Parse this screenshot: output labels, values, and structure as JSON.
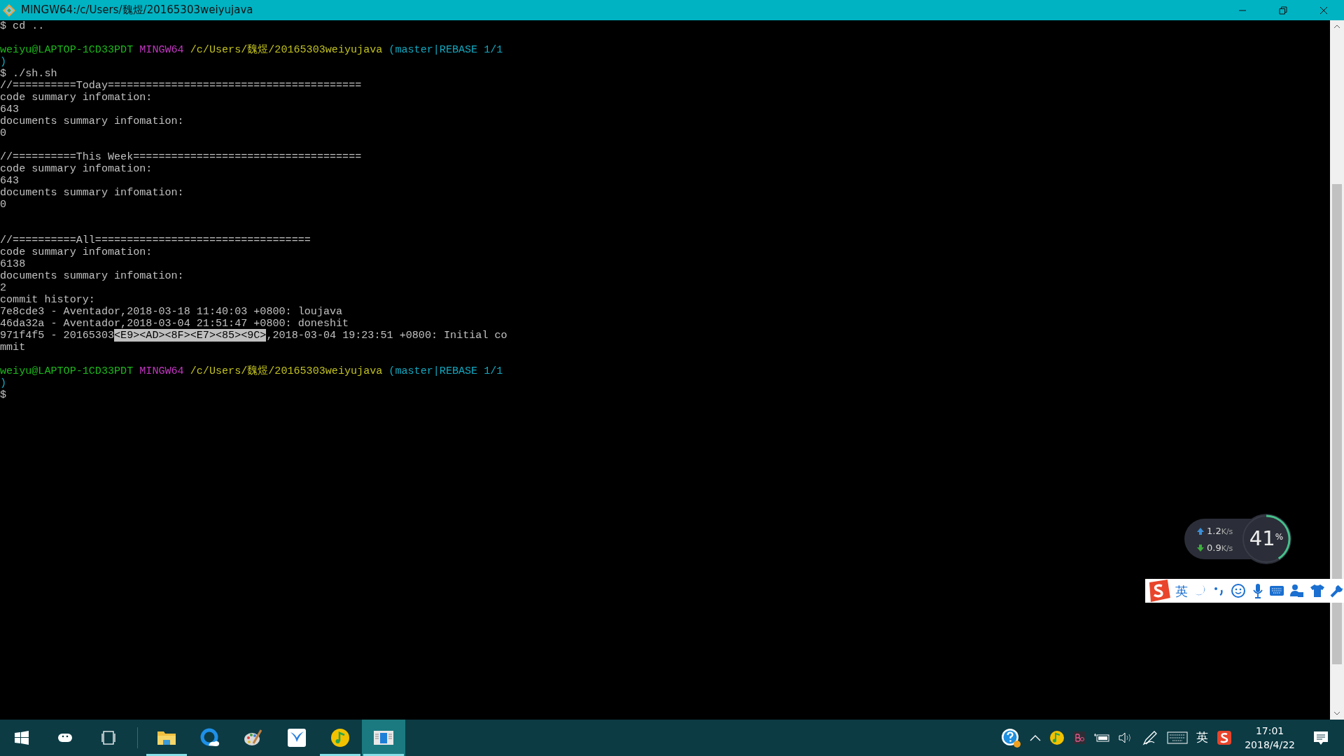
{
  "window": {
    "title": "MINGW64:/c/Users/魏煜/20165303weiyujava"
  },
  "terminal": {
    "lines": [
      {
        "segments": [
          {
            "kind": "plain",
            "text": "$ cd .."
          }
        ]
      },
      {
        "kind": "blank"
      },
      {
        "segments": [
          {
            "kind": "user",
            "text": "weiyu@LAPTOP-1CD33PDT"
          },
          {
            "kind": "shell",
            "text": " MINGW64"
          },
          {
            "kind": "path",
            "text": " /c/Users/魏煜/20165303weiyujava"
          },
          {
            "kind": "branch",
            "text": " (master|REBASE 1/1"
          }
        ]
      },
      {
        "segments": [
          {
            "kind": "branch",
            "text": ")"
          }
        ]
      },
      {
        "segments": [
          {
            "kind": "plain",
            "text": "$ ./sh.sh"
          }
        ]
      },
      {
        "segments": [
          {
            "kind": "plain",
            "text": "//==========Today========================================"
          }
        ]
      },
      {
        "segments": [
          {
            "kind": "plain",
            "text": "code summary infomation:"
          }
        ]
      },
      {
        "segments": [
          {
            "kind": "plain",
            "text": "643"
          }
        ]
      },
      {
        "segments": [
          {
            "kind": "plain",
            "text": "documents summary infomation:"
          }
        ]
      },
      {
        "segments": [
          {
            "kind": "plain",
            "text": "0"
          }
        ]
      },
      {
        "kind": "blank"
      },
      {
        "segments": [
          {
            "kind": "plain",
            "text": "//==========This Week===================================="
          }
        ]
      },
      {
        "segments": [
          {
            "kind": "plain",
            "text": "code summary infomation:"
          }
        ]
      },
      {
        "segments": [
          {
            "kind": "plain",
            "text": "643"
          }
        ]
      },
      {
        "segments": [
          {
            "kind": "plain",
            "text": "documents summary infomation:"
          }
        ]
      },
      {
        "segments": [
          {
            "kind": "plain",
            "text": "0"
          }
        ]
      },
      {
        "kind": "blank"
      },
      {
        "kind": "blank"
      },
      {
        "segments": [
          {
            "kind": "plain",
            "text": "//==========All=================================="
          }
        ]
      },
      {
        "segments": [
          {
            "kind": "plain",
            "text": "code summary infomation:"
          }
        ]
      },
      {
        "segments": [
          {
            "kind": "plain",
            "text": "6138"
          }
        ]
      },
      {
        "segments": [
          {
            "kind": "plain",
            "text": "documents summary infomation:"
          }
        ]
      },
      {
        "segments": [
          {
            "kind": "plain",
            "text": "2"
          }
        ]
      },
      {
        "segments": [
          {
            "kind": "plain",
            "text": "commit history:"
          }
        ]
      },
      {
        "segments": [
          {
            "kind": "plain",
            "text": "7e8cde3 - Aventador,2018-03-18 11:40:03 +0800: loujava"
          }
        ]
      },
      {
        "segments": [
          {
            "kind": "plain",
            "text": "46da32a - Aventador,2018-03-04 21:51:47 +0800: doneshit"
          }
        ]
      },
      {
        "segments": [
          {
            "kind": "plain",
            "text": "971f4f5 - 20165303"
          },
          {
            "kind": "selection",
            "text": "<E9><AD><8F><E7><85><9C>"
          },
          {
            "kind": "plain",
            "text": ",2018-03-04 19:23:51 +0800: Initial co"
          }
        ]
      },
      {
        "segments": [
          {
            "kind": "plain",
            "text": "mmit"
          }
        ]
      },
      {
        "kind": "blank"
      },
      {
        "segments": [
          {
            "kind": "user",
            "text": "weiyu@LAPTOP-1CD33PDT"
          },
          {
            "kind": "shell",
            "text": " MINGW64"
          },
          {
            "kind": "path",
            "text": " /c/Users/魏煜/20165303weiyujava"
          },
          {
            "kind": "branch",
            "text": " (master|REBASE 1/1"
          }
        ]
      },
      {
        "segments": [
          {
            "kind": "branch",
            "text": ")"
          }
        ]
      },
      {
        "segments": [
          {
            "kind": "plain",
            "text": "$"
          }
        ]
      }
    ]
  },
  "net_widget": {
    "upload": "1.2",
    "upload_unit": "K/s",
    "download": "0.9",
    "download_unit": "K/s",
    "usage": "41",
    "usage_unit": "%",
    "level": 0.41
  },
  "ime_toolbar": {
    "mode": "英"
  },
  "taskbar": {
    "items": [
      {
        "kind": "start",
        "running": false,
        "selected": false
      },
      {
        "kind": "cortana",
        "running": false,
        "selected": false
      },
      {
        "kind": "taskview",
        "running": false,
        "selected": false
      },
      {
        "kind": "explorer",
        "running": true,
        "selected": false
      },
      {
        "kind": "browser",
        "running": false,
        "selected": false
      },
      {
        "kind": "paint",
        "running": false,
        "selected": false
      },
      {
        "kind": "bird",
        "running": false,
        "selected": false
      },
      {
        "kind": "music",
        "running": true,
        "selected": false
      },
      {
        "kind": "terminal",
        "running": true,
        "selected": true
      }
    ],
    "tray": {
      "ime": "英",
      "time": "17:01",
      "date": "2018/4/22"
    }
  }
}
